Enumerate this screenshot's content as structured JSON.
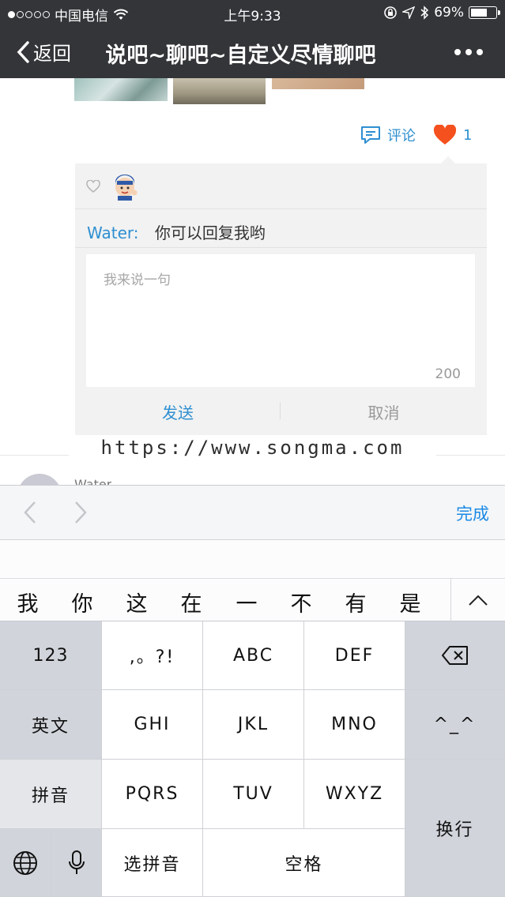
{
  "status_bar": {
    "carrier": "中国电信",
    "time": "上午9:33",
    "battery": "69%",
    "battery_level": 0.69,
    "signal_bars_filled": 1,
    "signal_bars_total": 5
  },
  "nav": {
    "back_label": "返回",
    "title": "说吧~聊吧~自定义尽情聊吧"
  },
  "post_actions": {
    "comment_label": "评论",
    "like_count": "1"
  },
  "comment_panel": {
    "reply_user": "Water:",
    "reply_text": "你可以回复我哟",
    "input_placeholder": "我来说一句",
    "char_limit": "200",
    "send_label": "发送",
    "cancel_label": "取消"
  },
  "watermark": "https://www.songma.com",
  "next_item": {
    "name": "Water"
  },
  "keyboard_accessory": {
    "done_label": "完成"
  },
  "candidates": [
    "我",
    "你",
    "这",
    "在",
    "一",
    "不",
    "有",
    "是"
  ],
  "keyboard": {
    "num_key": "123",
    "punct_key": ",。?!",
    "abc": "ABC",
    "def": "DEF",
    "english_key": "英文",
    "ghi": "GHI",
    "jkl": "JKL",
    "mno": "MNO",
    "emoticon_key": "^_^",
    "pinyin_key": "拼音",
    "pqrs": "PQRS",
    "tuv": "TUV",
    "wxyz": "WXYZ",
    "newline_key": "换行",
    "select_pinyin_key": "选拼音",
    "space_key": "空格"
  },
  "colors": {
    "nav_bg": "#333538",
    "accent_blue": "#2e8fd1",
    "like_orange": "#f4511e",
    "done_blue": "#1a8ae6"
  }
}
